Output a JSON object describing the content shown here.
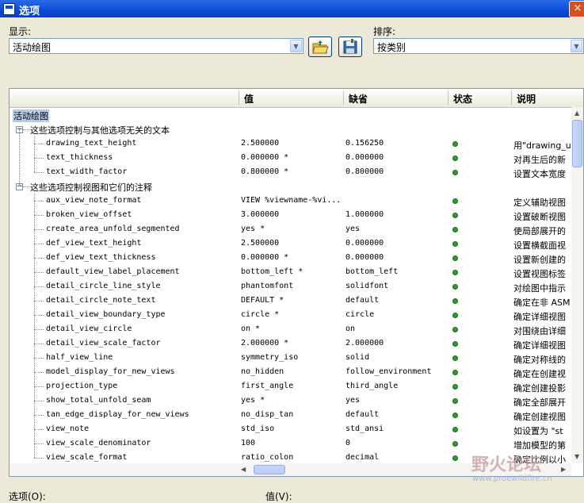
{
  "window": {
    "title": "选项"
  },
  "toolbar": {
    "show_label": "显示:",
    "show_value": "活动绘图",
    "sort_label": "排序:",
    "sort_value": "按类别",
    "open_icon": "folder-open-icon",
    "save_icon": "save-icon"
  },
  "columns": {
    "name": "",
    "value": "值",
    "default": "缺省",
    "status": "状态",
    "desc": "说明"
  },
  "tree": {
    "root": "活动绘图",
    "groups": [
      {
        "label": "这些选项控制与其他选项无关的文本",
        "rows": [
          {
            "name": "drawing_text_height",
            "value": "2.500000",
            "default": "0.156250",
            "desc": "用\"drawing_u"
          },
          {
            "name": "text_thickness",
            "value": "0.000000 *",
            "default": "0.000000",
            "desc": "对再生后的新"
          },
          {
            "name": "text_width_factor",
            "value": "0.800000 *",
            "default": "0.800000",
            "desc": "设置文本宽度"
          }
        ]
      },
      {
        "label": "这些选项控制视图和它们的注释",
        "rows": [
          {
            "name": "aux_view_note_format",
            "value": "VIEW %viewname-%vi...",
            "default": "",
            "desc": "定义辅助视图"
          },
          {
            "name": "broken_view_offset",
            "value": "3.000000",
            "default": "1.000000",
            "desc": "设置破断视图"
          },
          {
            "name": "create_area_unfold_segmented",
            "value": "yes *",
            "default": "yes",
            "desc": "使局部展开的"
          },
          {
            "name": "def_view_text_height",
            "value": "2.500000",
            "default": "0.000000",
            "desc": "设置横截面视"
          },
          {
            "name": "def_view_text_thickness",
            "value": "0.000000 *",
            "default": "0.000000",
            "desc": "设置新创建的"
          },
          {
            "name": "default_view_label_placement",
            "value": "bottom_left *",
            "default": "bottom_left",
            "desc": "设置视图标签"
          },
          {
            "name": "detail_circle_line_style",
            "value": "phantomfont",
            "default": "solidfont",
            "desc": "对绘图中指示"
          },
          {
            "name": "detail_circle_note_text",
            "value": "DEFAULT *",
            "default": "default",
            "desc": "确定在非 ASM"
          },
          {
            "name": "detail_view_boundary_type",
            "value": "circle *",
            "default": "circle",
            "desc": "确定详细视图"
          },
          {
            "name": "detail_view_circle",
            "value": "on *",
            "default": "on",
            "desc": "对围绕由详细"
          },
          {
            "name": "detail_view_scale_factor",
            "value": "2.000000 *",
            "default": "2.000000",
            "desc": "确定详细视图"
          },
          {
            "name": "half_view_line",
            "value": "symmetry_iso",
            "default": "solid",
            "desc": "确定对称线的"
          },
          {
            "name": "model_display_for_new_views",
            "value": "no_hidden",
            "default": "follow_environment",
            "desc": "确定在创建视"
          },
          {
            "name": "projection_type",
            "value": "first_angle",
            "default": "third_angle",
            "desc": "确定创建投影"
          },
          {
            "name": "show_total_unfold_seam",
            "value": "yes *",
            "default": "yes",
            "desc": "确定全部展开"
          },
          {
            "name": "tan_edge_display_for_new_views",
            "value": "no_disp_tan",
            "default": "default",
            "desc": "确定创建视图"
          },
          {
            "name": "view_note",
            "value": "std_iso",
            "default": "std_ansi",
            "desc": "如设置为 \"st"
          },
          {
            "name": "view_scale_denominator",
            "value": "100",
            "default": "0",
            "desc": "增加模型的第"
          },
          {
            "name": "view_scale_format",
            "value": "ratio_colon",
            "default": "decimal",
            "desc": "确定比例以小"
          }
        ]
      }
    ]
  },
  "bottom": {
    "option_label": "选项(O):",
    "value_label": "值(V):"
  },
  "watermark": {
    "text": "野火论坛",
    "url": "www.proewildfire.cn"
  },
  "colors": {
    "status_ok": "#2d9b2d",
    "titlebar": "#0a49d6",
    "selection": "#b6cbe8"
  }
}
